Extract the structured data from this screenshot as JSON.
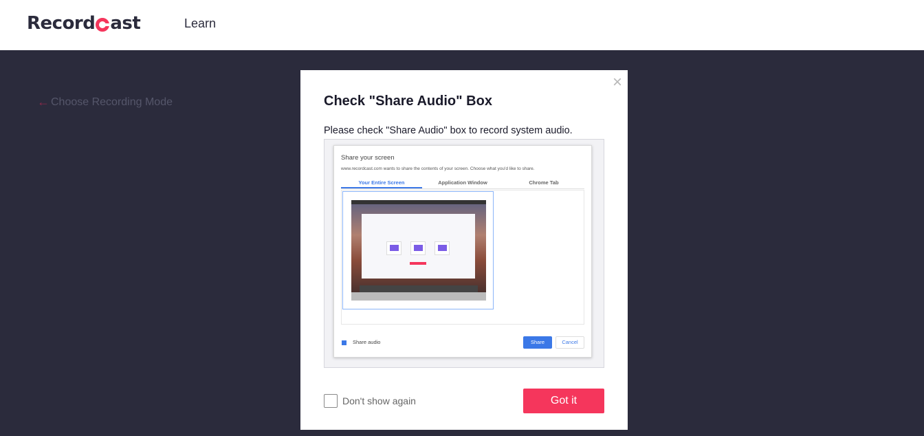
{
  "header": {
    "logo_text_before": "Record",
    "logo_text_after": "ast",
    "nav_learn": "Learn"
  },
  "background": {
    "back_label": "Choose Recording Mode"
  },
  "modal": {
    "title": "Check \"Share Audio\" Box",
    "description": "Please check \"Share Audio\" box to record system audio.",
    "close_icon": "×",
    "illustration": {
      "title": "Share your screen",
      "subtitle": "www.recordcast.com wants to share the contents of your screen. Choose what you'd like to share.",
      "tabs": [
        "Your Entire Screen",
        "Application Window",
        "Chrome Tab"
      ],
      "share_audio_label": "Share audio",
      "share_button": "Share",
      "cancel_button": "Cancel"
    },
    "dont_show_label": "Don't show again",
    "got_it_label": "Got it"
  },
  "colors": {
    "accent": "#f5365c",
    "background": "#2b2b3c",
    "chrome_blue": "#3b78e7"
  }
}
